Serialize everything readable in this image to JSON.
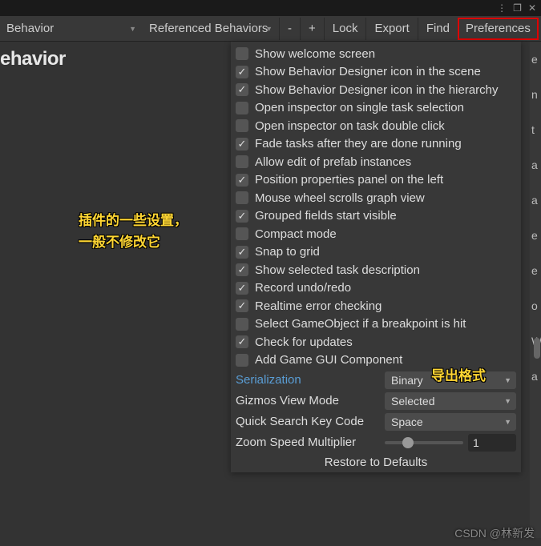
{
  "titlebar": {
    "menu": "⋮",
    "max": "❐",
    "close": "✕"
  },
  "toolbar": {
    "behavior_dd": "Behavior",
    "ref_dd": "Referenced Behaviors",
    "minus": "-",
    "plus": "+",
    "lock": "Lock",
    "export": "Export",
    "find": "Find",
    "preferences": "Preferences"
  },
  "title": "ehavior",
  "annotation1_l1": "插件的一些设置，",
  "annotation1_l2": "一般不修改它",
  "annotation2": "导出格式",
  "checks": [
    {
      "label": "Show welcome screen",
      "on": false
    },
    {
      "label": "Show Behavior Designer icon in the scene",
      "on": true
    },
    {
      "label": "Show Behavior Designer icon in the hierarchy",
      "on": true
    },
    {
      "label": "Open inspector on single task selection",
      "on": false
    },
    {
      "label": "Open inspector on task double click",
      "on": false
    },
    {
      "label": "Fade tasks after they are done running",
      "on": true
    },
    {
      "label": "Allow edit of prefab instances",
      "on": false
    },
    {
      "label": "Position properties panel on the left",
      "on": true
    },
    {
      "label": "Mouse wheel scrolls graph view",
      "on": false
    },
    {
      "label": "Grouped fields start visible",
      "on": true
    },
    {
      "label": "Compact mode",
      "on": false
    },
    {
      "label": "Snap to grid",
      "on": true
    },
    {
      "label": "Show selected task description",
      "on": true
    },
    {
      "label": "Record undo/redo",
      "on": true
    },
    {
      "label": "Realtime error checking",
      "on": true
    },
    {
      "label": "Select GameObject if a breakpoint is hit",
      "on": false
    },
    {
      "label": "Check for updates",
      "on": true
    },
    {
      "label": "Add Game GUI Component",
      "on": false
    }
  ],
  "fields": {
    "serialization": {
      "label": "Serialization",
      "value": "Binary"
    },
    "gizmos": {
      "label": "Gizmos View Mode",
      "value": "Selected"
    },
    "quicksearch": {
      "label": "Quick Search Key Code",
      "value": "Space"
    },
    "zoom": {
      "label": "Zoom Speed Multiplier",
      "value": "1"
    }
  },
  "restore": "Restore to Defaults",
  "watermark": "CSDN @林新发"
}
